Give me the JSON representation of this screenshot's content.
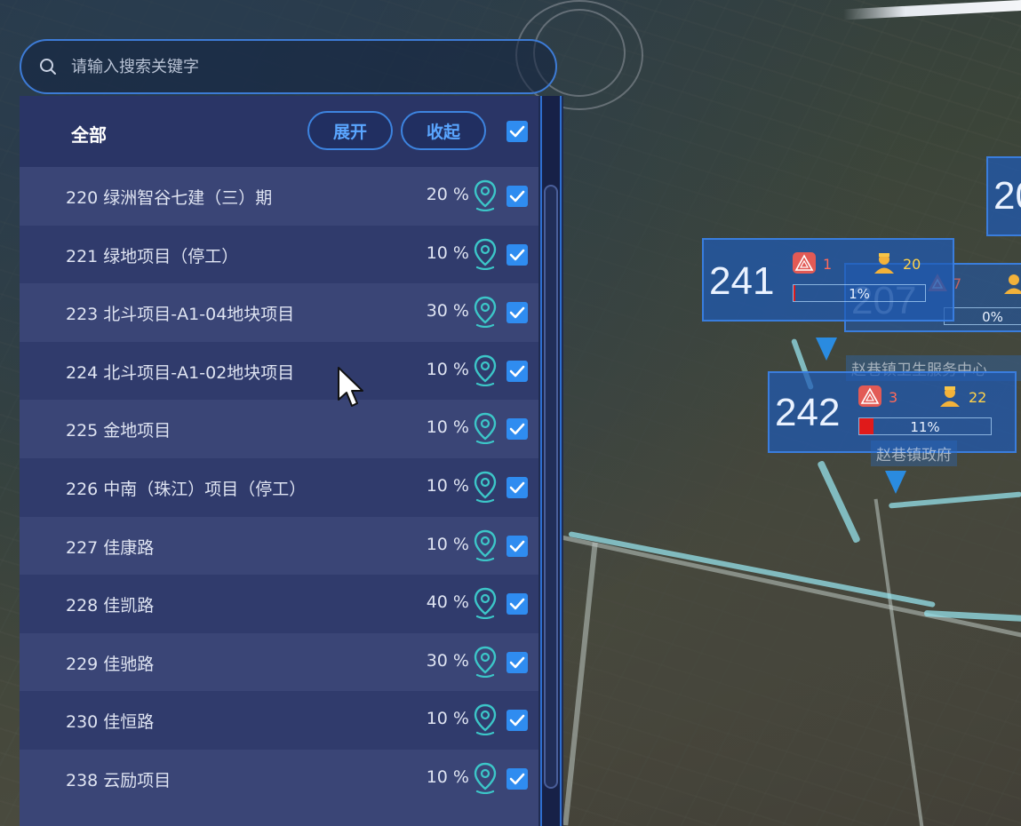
{
  "search": {
    "placeholder": "请输入搜索关键字",
    "icon": "search-icon"
  },
  "header": {
    "all_label": "全部",
    "expand_label": "展开",
    "collapse_label": "收起",
    "all_checked": true
  },
  "colors": {
    "accent": "#2f8cf0",
    "pin": "#3cc6c8",
    "alarm": "#ff6a5a",
    "person": "#ffd24a"
  },
  "items": [
    {
      "label": "220 绿洲智谷七建（三）期",
      "pct": "20 %",
      "checked": true
    },
    {
      "label": "221 绿地项目（停工）",
      "pct": "10 %",
      "checked": true
    },
    {
      "label": "223 北斗项目-A1-04地块项目",
      "pct": "30 %",
      "checked": true
    },
    {
      "label": "224 北斗项目-A1-02地块项目",
      "pct": "10 %",
      "checked": true
    },
    {
      "label": "225 金地项目",
      "pct": "10 %",
      "checked": true
    },
    {
      "label": "226 中南（珠江）项目（停工）",
      "pct": "10 %",
      "checked": true
    },
    {
      "label": "227 佳康路",
      "pct": "10 %",
      "checked": true
    },
    {
      "label": "228 佳凯路",
      "pct": "40 %",
      "checked": true
    },
    {
      "label": "229 佳驰路",
      "pct": "30 %",
      "checked": true
    },
    {
      "label": "230 佳恒路",
      "pct": "10 %",
      "checked": true
    },
    {
      "label": "238 云励项目",
      "pct": "10 %",
      "checked": true
    }
  ],
  "map_markers": [
    {
      "id": "241",
      "alarm_count": "1",
      "person_count": "20",
      "progress": "1%",
      "progress_value": 0.01
    },
    {
      "id": "207",
      "alarm_count": "7",
      "person_count": "",
      "progress": "0%",
      "progress_value": 0.0
    },
    {
      "id": "242",
      "alarm_count": "3",
      "person_count": "22",
      "progress": "11%",
      "progress_value": 0.11
    },
    {
      "id": "20",
      "alarm_count": "",
      "person_count": "",
      "progress": "",
      "progress_value": 0
    }
  ],
  "map_labels": [
    "赵巷镇卫生服务中心",
    "赵巷镇政府"
  ]
}
